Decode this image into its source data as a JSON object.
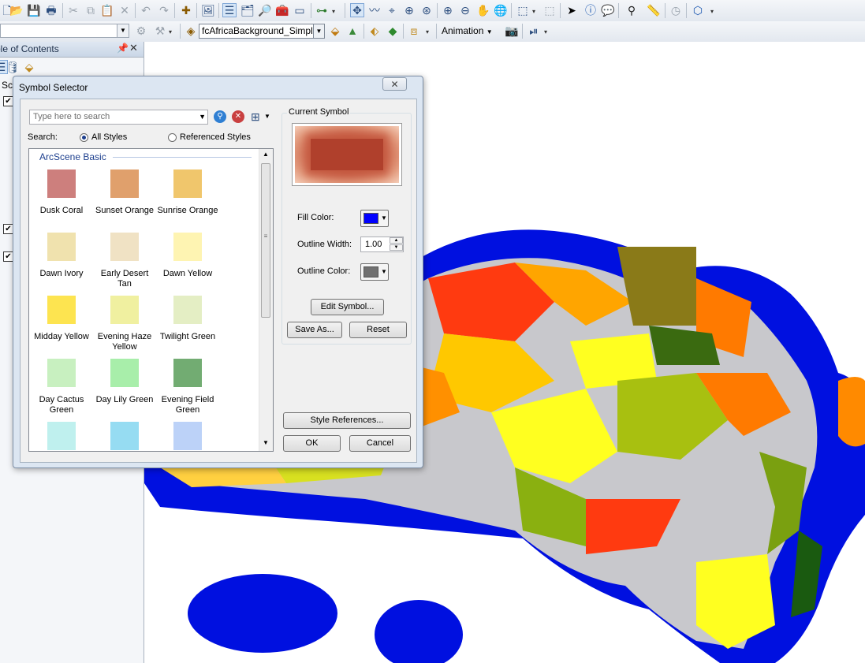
{
  "toolbar": {
    "layer_combo": "fcAfricaBackground_Simpl",
    "animation_label": "Animation"
  },
  "toc": {
    "title": "ble of Contents",
    "layer_label": "Sc"
  },
  "dialog": {
    "title": "Symbol Selector",
    "close_glyph": "✕",
    "search_placeholder": "Type here to search",
    "search_label": "Search:",
    "radio_all": "All Styles",
    "radio_referenced": "Referenced Styles",
    "group_header": "ArcScene Basic",
    "symbols": [
      {
        "label": "Dusk Coral",
        "color": "#cd7f7d"
      },
      {
        "label": "Sunset Orange",
        "color": "#e0a06c"
      },
      {
        "label": "Sunrise Orange",
        "color": "#f0c66c"
      },
      {
        "label": "Dawn Ivory",
        "color": "#f0e2ae"
      },
      {
        "label": "Early Desert Tan",
        "color": "#f0e2c4"
      },
      {
        "label": "Dawn Yellow",
        "color": "#fef4b2"
      },
      {
        "label": "Midday Yellow",
        "color": "#fde450"
      },
      {
        "label": "Evening Haze Yellow",
        "color": "#f0f0a0"
      },
      {
        "label": "Twilight Green",
        "color": "#e4eec4"
      },
      {
        "label": "Day Cactus Green",
        "color": "#c8f0c0"
      },
      {
        "label": "Day Lily Green",
        "color": "#a8eeaa"
      },
      {
        "label": "Evening Field Green",
        "color": "#72ac72"
      },
      {
        "label": "",
        "color": "#bff0ee"
      },
      {
        "label": "",
        "color": "#96dcf2"
      },
      {
        "label": "",
        "color": "#bcd2f8"
      }
    ],
    "current_symbol_label": "Current Symbol",
    "fill_color_label": "Fill Color:",
    "fill_color": "#0000ff",
    "outline_width_label": "Outline Width:",
    "outline_width": "1.00",
    "outline_color_label": "Outline Color:",
    "outline_color": "#707070",
    "edit_symbol_label": "Edit Symbol...",
    "save_as_label": "Save As...",
    "reset_label": "Reset",
    "style_references_label": "Style References...",
    "ok_label": "OK",
    "cancel_label": "Cancel"
  }
}
